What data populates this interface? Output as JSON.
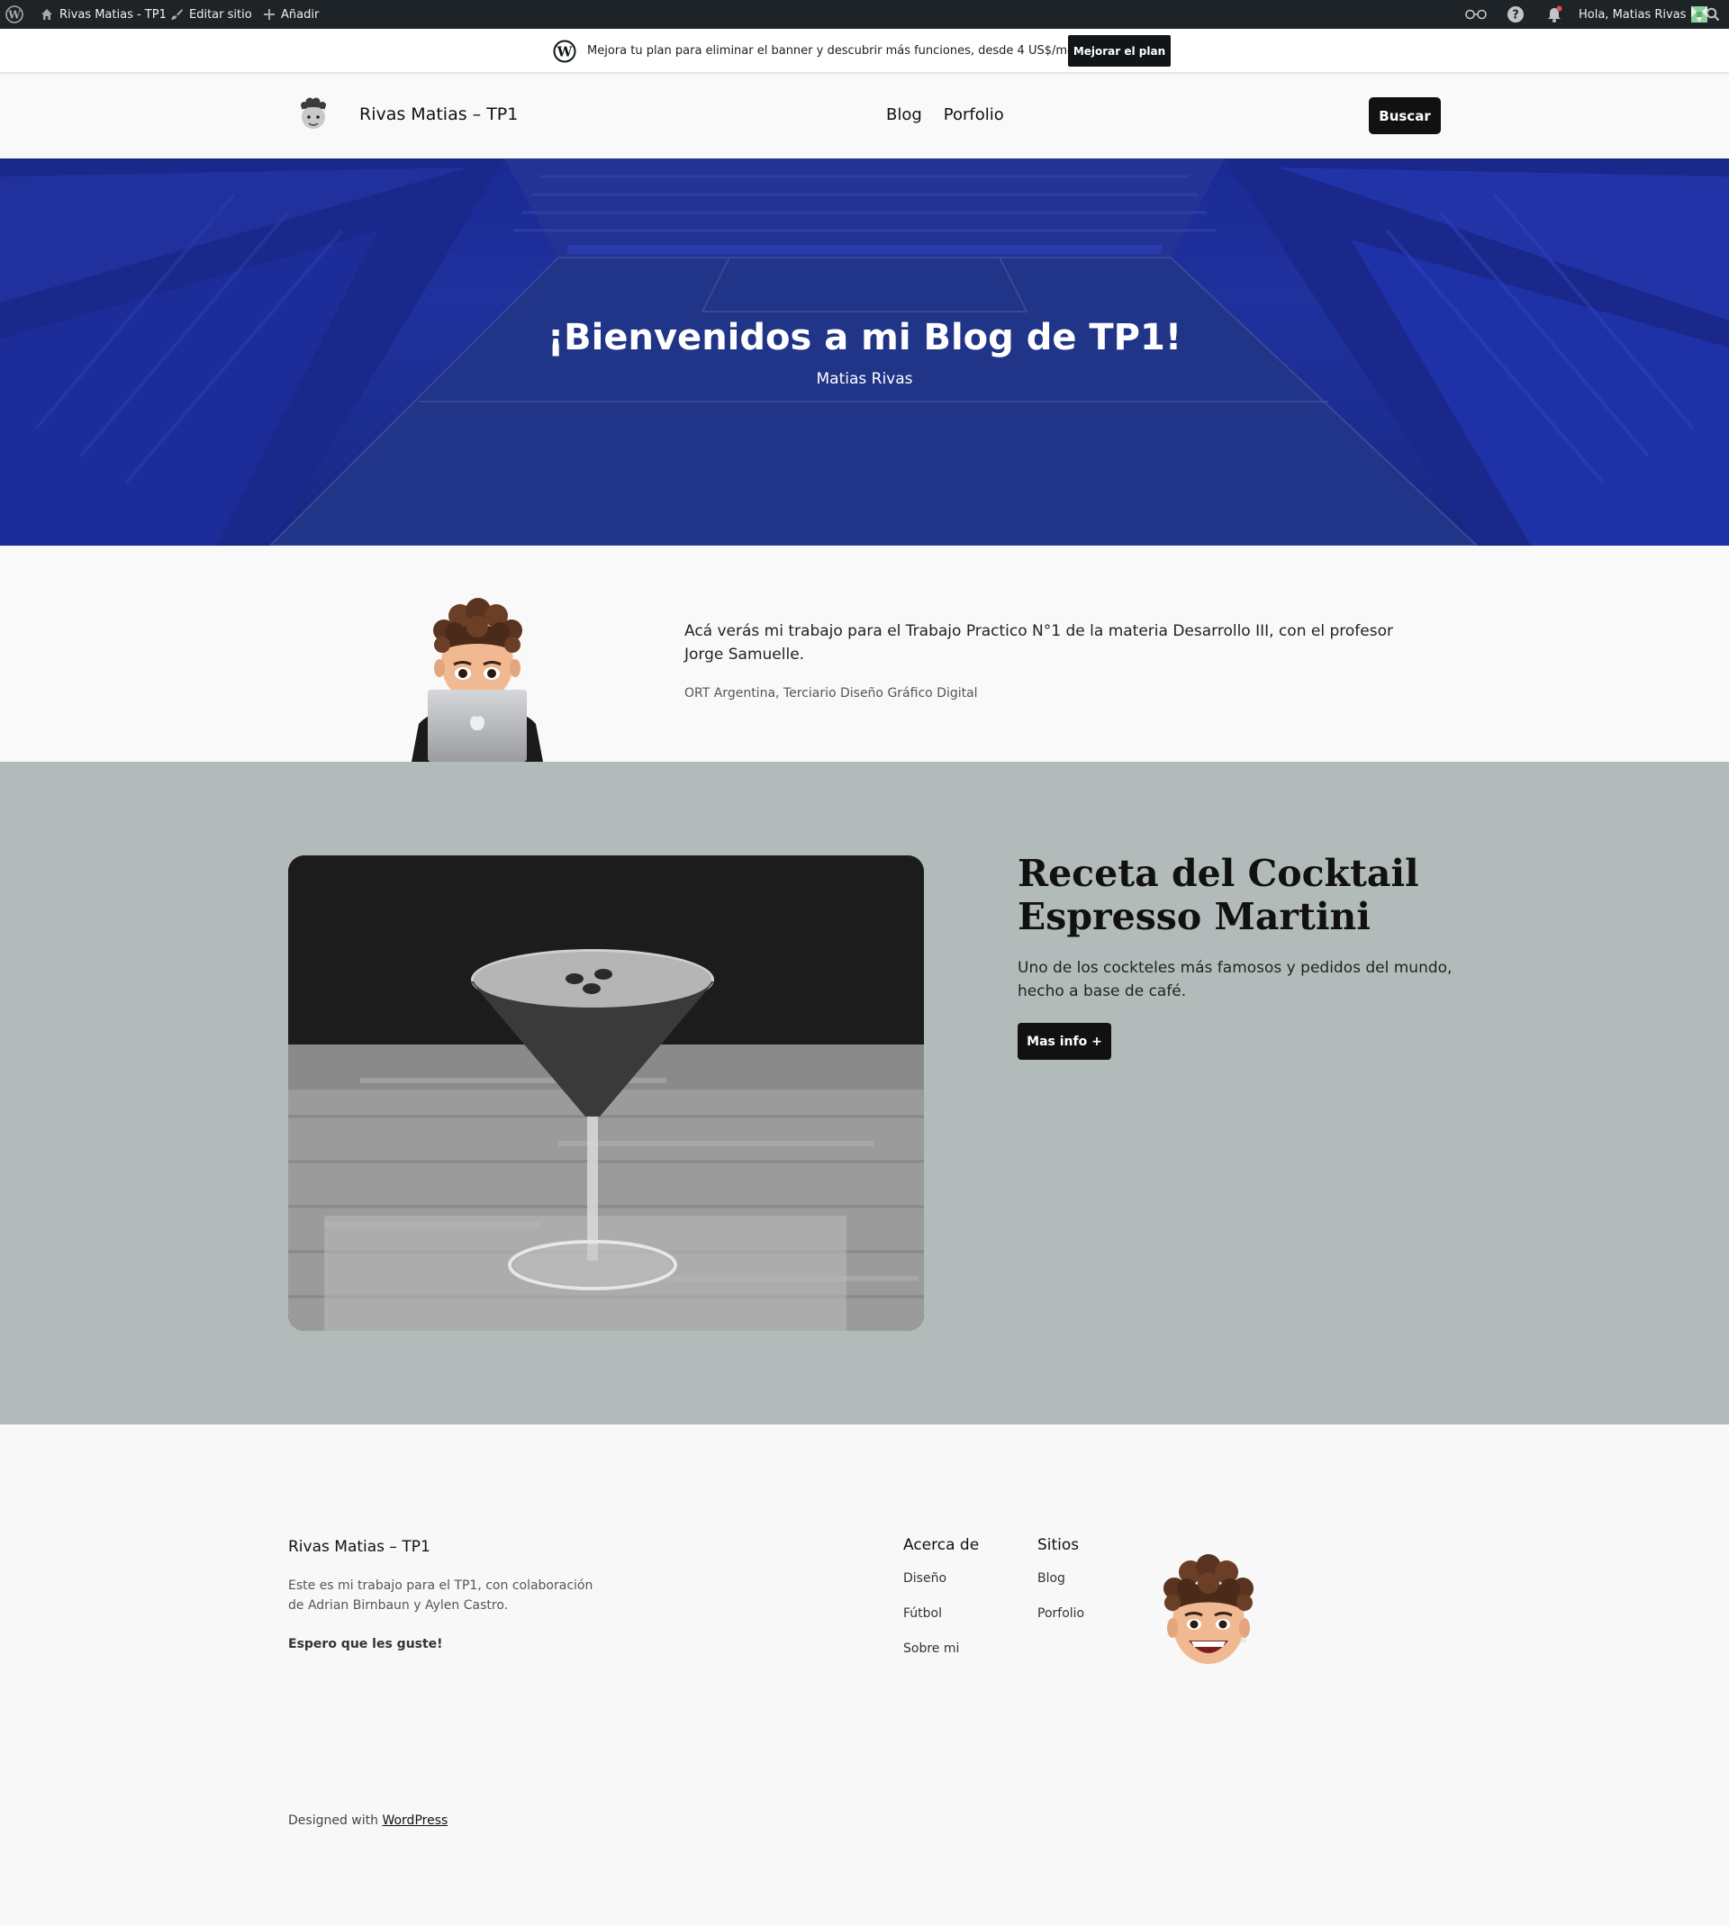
{
  "admin_bar": {
    "site_name": "Rivas Matias - TP1",
    "edit_site": "Editar sitio",
    "add_new": "Añadir",
    "greeting": "Hola, Matias Rivas"
  },
  "promo_banner": {
    "text": "Mejora tu plan para eliminar el banner y descubrir más funciones, desde 4 US$/mes.",
    "button": "Mejorar el plan"
  },
  "header": {
    "site_title": "Rivas Matias – TP1",
    "nav": [
      "Blog",
      "Porfolio"
    ],
    "search_button": "Buscar"
  },
  "hero": {
    "title": "¡Bienvenidos a mi Blog de TP1!",
    "subtitle": "Matias Rivas",
    "overlay_color": "#1e2fa0"
  },
  "about": {
    "text": "Acá verás mi trabajo para el Trabajo Practico N°1 de la materia Desarrollo III, con el profesor Jorge Samuelle.",
    "subtext": "ORT Argentina, Terciario Diseño Gráfico Digital"
  },
  "feature": {
    "title": "Receta del Cocktail Espresso Martini",
    "description": "Uno de los cockteles más famosos y pedidos del mundo, hecho a base de café.",
    "button": "Mas info +",
    "background_color": "#b3bbba"
  },
  "footer": {
    "site_title": "Rivas Matias – TP1",
    "description": "Este es mi trabajo para el TP1, con colaboración de Adrian Birnbaun y Aylen Castro.",
    "bold_note": "Espero que les guste!",
    "columns": [
      {
        "heading": "Acerca de",
        "links": [
          "Diseño",
          "Fútbol",
          "Sobre mi"
        ]
      },
      {
        "heading": "Sitios",
        "links": [
          "Blog",
          "Porfolio"
        ]
      }
    ],
    "credit_prefix": "Designed with",
    "credit_link": "WordPress"
  }
}
